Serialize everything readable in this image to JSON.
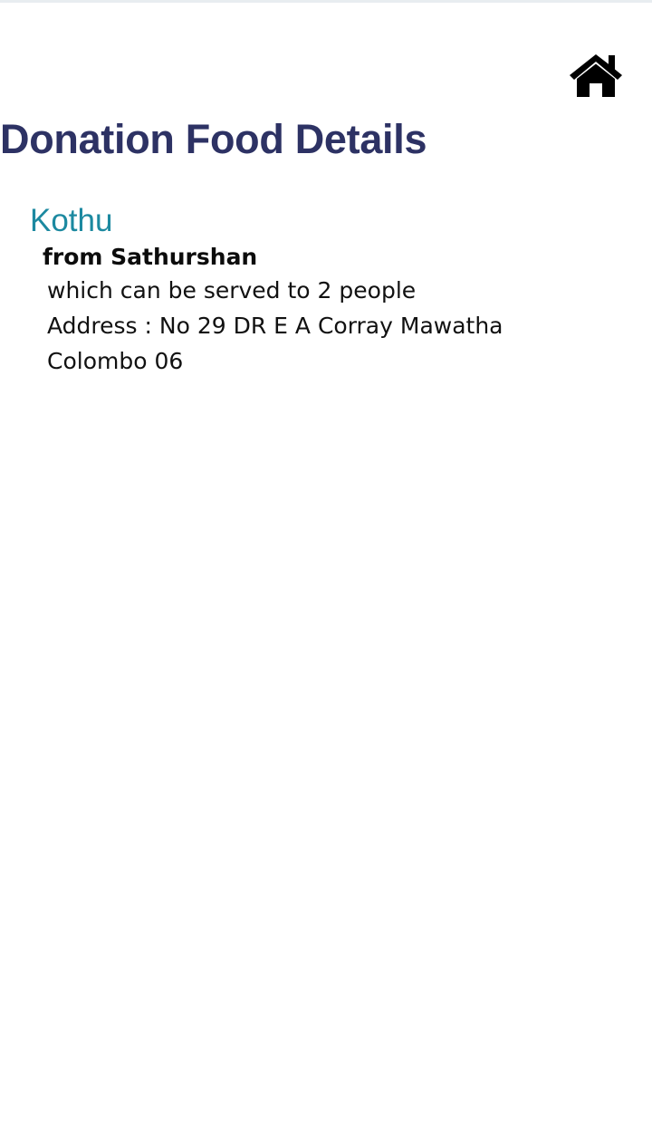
{
  "header": {
    "home_icon": "home-icon",
    "title": "Donation Food Details"
  },
  "donation": {
    "food_name": "Kothu",
    "donor_text": "from Sathurshan",
    "serves_text": "which can be served to 2 people",
    "address_text": "Address : No 29 DR E A Corray Mawatha",
    "city_text": "Colombo 06"
  },
  "colors": {
    "title": "#2d3264",
    "food_name": "#1c89a0",
    "text": "#111111"
  }
}
